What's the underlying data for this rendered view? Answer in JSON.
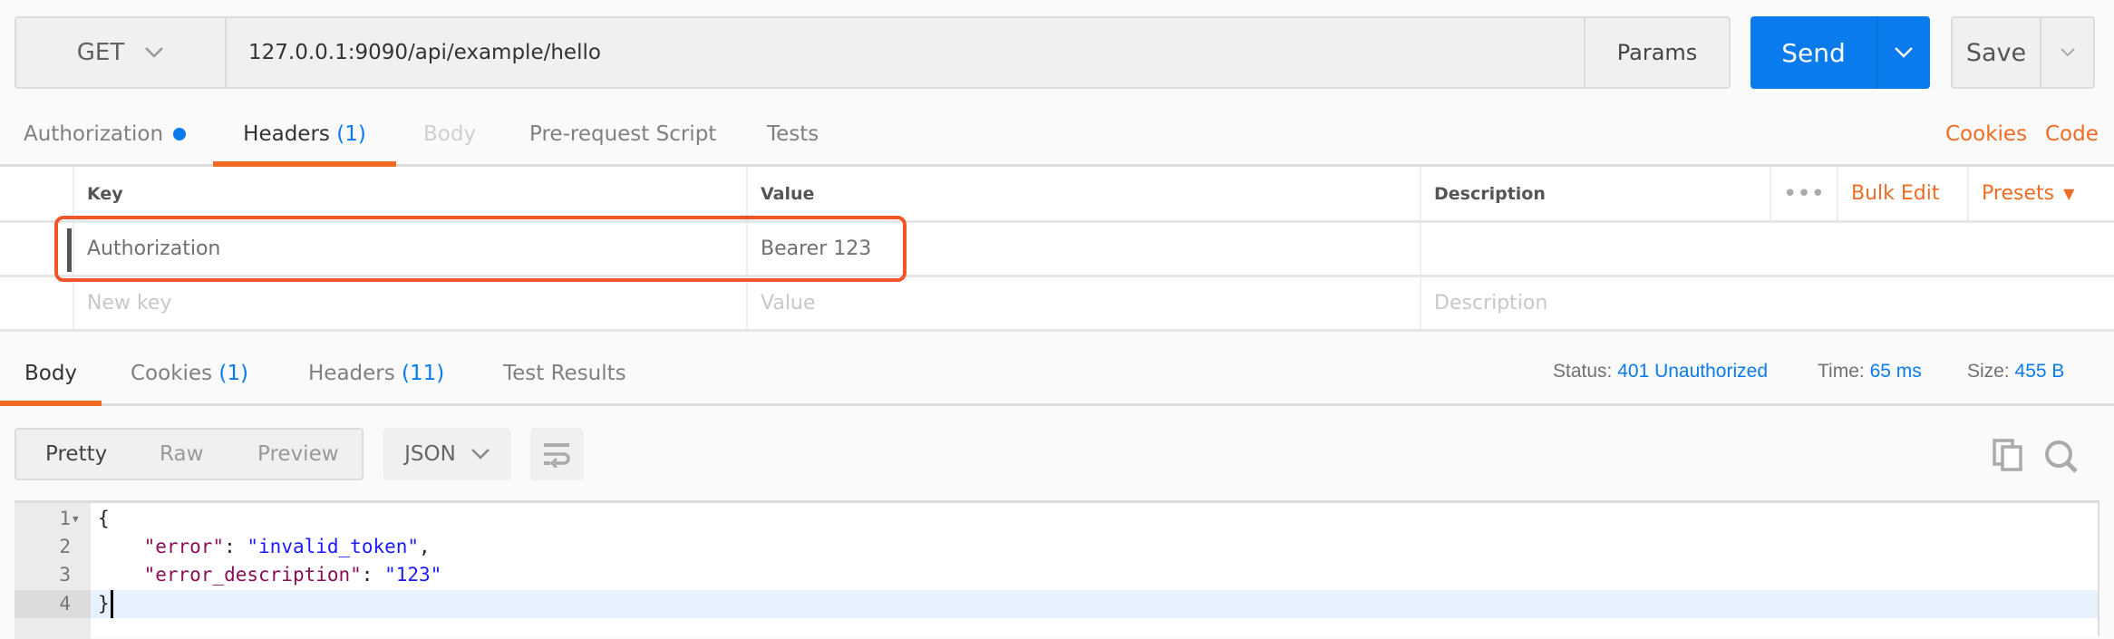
{
  "request": {
    "method": "GET",
    "url": "127.0.0.1:9090/api/example/hello",
    "params_label": "Params",
    "send_label": "Send",
    "save_label": "Save"
  },
  "request_tabs": [
    {
      "label": "Authorization",
      "indicator": "dot"
    },
    {
      "label": "Headers",
      "count": "(1)",
      "active": true
    },
    {
      "label": "Body",
      "disabled": true
    },
    {
      "label": "Pre-request Script"
    },
    {
      "label": "Tests"
    }
  ],
  "request_links": {
    "cookies": "Cookies",
    "code": "Code"
  },
  "headers_table": {
    "columns": [
      "Key",
      "Value",
      "Description"
    ],
    "bulk_edit": "Bulk Edit",
    "presets": "Presets",
    "rows": [
      {
        "key": "Authorization",
        "value": "Bearer 123",
        "description": ""
      }
    ],
    "placeholders": {
      "key": "New key",
      "value": "Value",
      "description": "Description"
    }
  },
  "response_tabs": [
    {
      "label": "Body",
      "active": true
    },
    {
      "label": "Cookies",
      "count": "(1)"
    },
    {
      "label": "Headers",
      "count": "(11)"
    },
    {
      "label": "Test Results"
    }
  ],
  "response_meta": {
    "status_label": "Status:",
    "status": "401 Unauthorized",
    "time_label": "Time:",
    "time": "65 ms",
    "size_label": "Size:",
    "size": "455 B"
  },
  "format": {
    "modes": [
      "Pretty",
      "Raw",
      "Preview"
    ],
    "active": "Pretty",
    "language": "JSON"
  },
  "body_lines": [
    {
      "n": "1",
      "text": "{"
    },
    {
      "n": "2",
      "key": "\"error\"",
      "value": "\"invalid_token\"",
      "trail": ","
    },
    {
      "n": "3",
      "key": "\"error_description\"",
      "value": "\"123\"",
      "trail": ""
    },
    {
      "n": "4",
      "text": "}"
    }
  ],
  "colors": {
    "accent": "#f26b24",
    "primary": "#097bed",
    "highlight_box": "#f0562a"
  }
}
